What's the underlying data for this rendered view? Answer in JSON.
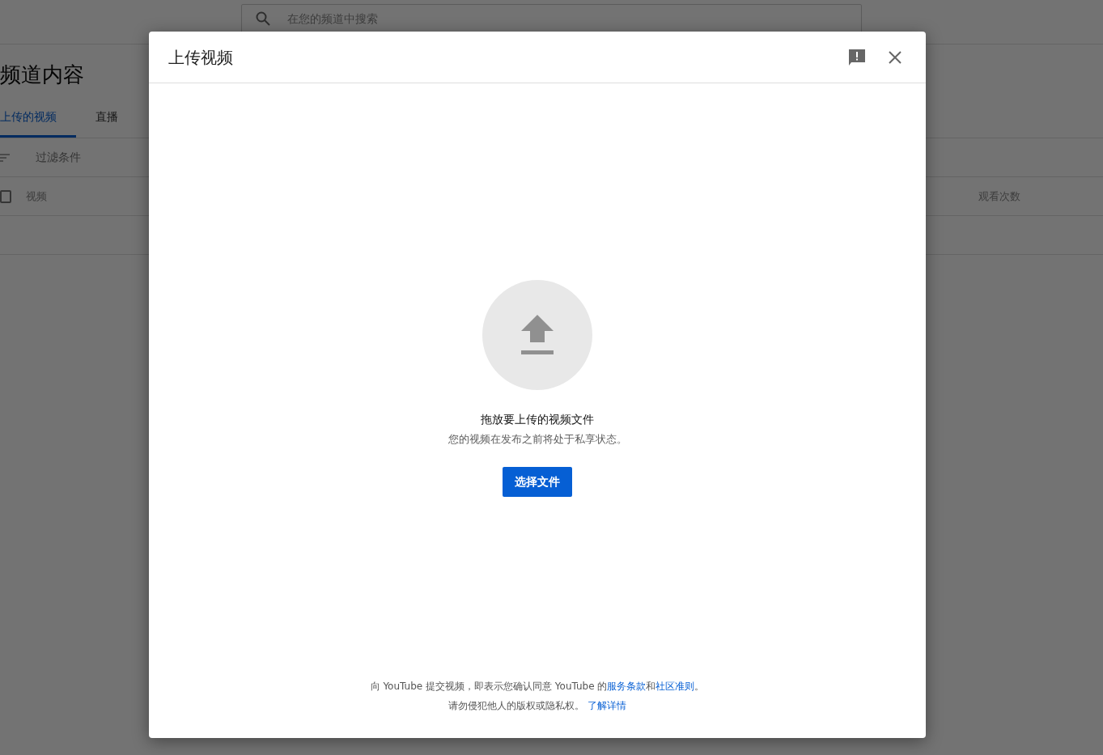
{
  "page": {
    "search": {
      "placeholder": "在您的频道中搜索"
    },
    "title": "频道内容",
    "tabs": [
      {
        "label": "上传的视频",
        "selected": true
      },
      {
        "label": "直播",
        "selected": false
      }
    ],
    "filter": {
      "placeholder": "过滤条件"
    },
    "table": {
      "select_all": {
        "checked": false
      },
      "columns": [
        "视频",
        "观看次数"
      ]
    }
  },
  "dialog": {
    "title": "上传视频",
    "drop_title": "拖放要上传的视频文件",
    "drop_note": "您的视频在发布之前将处于私享状态。",
    "button": "选择文件",
    "terms": [
      {
        "kind": "text",
        "text": "向 YouTube 提交视频，即表示您确认同意 YouTube 的"
      },
      {
        "kind": "link",
        "text": "服务条款"
      },
      {
        "kind": "text",
        "text": "和"
      },
      {
        "kind": "link",
        "text": "社区准则"
      },
      {
        "kind": "text",
        "text": "。"
      }
    ],
    "notice": [
      {
        "kind": "text",
        "text": "请勿侵犯他人的版权或隐私权。 "
      },
      {
        "kind": "link",
        "text": "了解详情"
      }
    ]
  }
}
